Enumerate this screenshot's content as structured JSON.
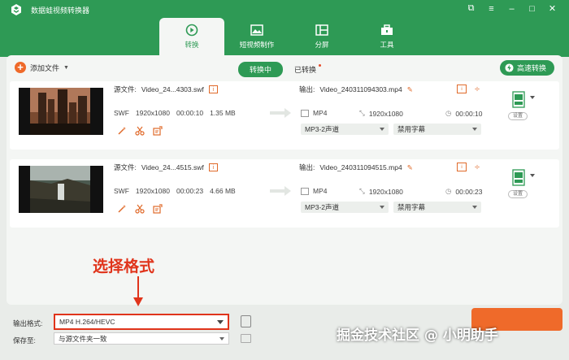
{
  "app": {
    "title": "数据蛙视频转换器"
  },
  "window_controls": [
    "⧉",
    "≡",
    "–",
    "□",
    "✕"
  ],
  "tabs": [
    {
      "label": "转换",
      "icon": "convert-icon",
      "active": true
    },
    {
      "label": "短视频制作",
      "icon": "image-icon",
      "active": false
    },
    {
      "label": "分屏",
      "icon": "split-screen-icon",
      "active": false
    },
    {
      "label": "工具",
      "icon": "toolbox-icon",
      "active": false
    }
  ],
  "toolbar": {
    "add_file": "添加文件",
    "converting": "转换中",
    "converted": "已转换",
    "fast_convert": "高速转换"
  },
  "files": [
    {
      "source_label": "源文件:",
      "source_name": "Video_24...4303.swf",
      "format": "SWF",
      "resolution": "1920x1080",
      "duration": "00:00:10",
      "size": "1.35 MB",
      "output_label": "输出:",
      "output_name": "Video_240311094303.mp4",
      "out_format": "MP4",
      "out_resolution": "1920x1080",
      "out_duration": "00:00:10",
      "audio": "MP3-2声道",
      "subtitle": "禁用字幕",
      "settings": "设置"
    },
    {
      "source_label": "源文件:",
      "source_name": "Video_24...4515.swf",
      "format": "SWF",
      "resolution": "1920x1080",
      "duration": "00:00:23",
      "size": "4.66 MB",
      "output_label": "输出:",
      "output_name": "Video_240311094515.mp4",
      "out_format": "MP4",
      "out_resolution": "1920x1080",
      "out_duration": "00:00:23",
      "audio": "MP3-2声道",
      "subtitle": "禁用字幕",
      "settings": "设置"
    }
  ],
  "bottom": {
    "output_format_label": "输出格式:",
    "output_format_value": "MP4 H.264/HEVC",
    "save_to_label": "保存至:",
    "save_to_value": "与源文件夹一致"
  },
  "annotation": {
    "text": "选择格式"
  },
  "watermark": "掘金技术社区 @ 小明助手",
  "colors": {
    "brand_green": "#2e9a55",
    "accent_orange": "#ef6a2a",
    "highlight_red": "#e0341b"
  }
}
